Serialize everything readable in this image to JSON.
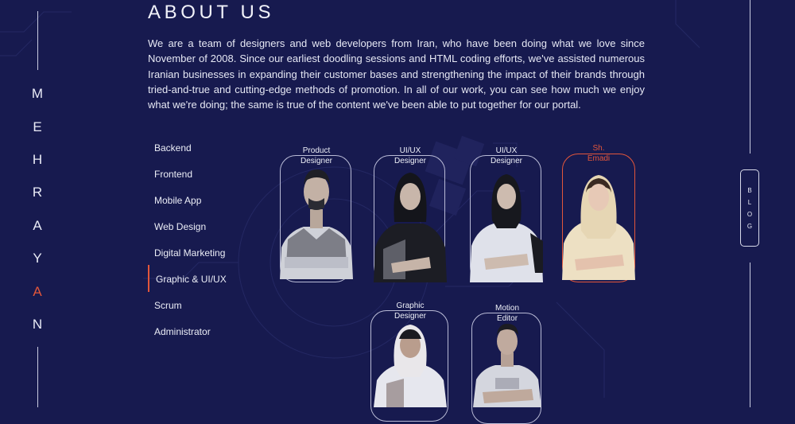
{
  "brand": {
    "letters": [
      "M",
      "E",
      "H",
      "R",
      "A",
      "Y",
      "A",
      "N"
    ],
    "accent_color": "#e2563b"
  },
  "about": {
    "title": "ABOUT US",
    "paragraph": "We are a team of designers and web developers from Iran, who have been doing what we love since November of 2008. Since our earliest doodling sessions and HTML coding efforts, we've assisted numerous Iranian businesses in expanding their customer bases and strengthening the impact of their brands through tried-and-true and cutting-edge methods of promotion. In all of our work, you can see how much we enjoy what we're doing; the same is true of the content we've been able to put together for our portal."
  },
  "menu": {
    "items": [
      "Backend",
      "Frontend",
      "Mobile App",
      "Web Design",
      "Digital Marketing",
      "Graphic & UI/UX",
      "Scrum",
      "Administrator"
    ],
    "active": "Graphic & UI/UX"
  },
  "team": [
    {
      "role_line1": "Product",
      "role_line2": "Designer",
      "highlighted": false,
      "icon": "person-photo-man-plaid-shirt"
    },
    {
      "role_line1": "UI/UX",
      "role_line2": "Designer",
      "highlighted": false,
      "icon": "person-photo-woman-hijab"
    },
    {
      "role_line1": "UI/UX",
      "role_line2": "Designer",
      "highlighted": false,
      "icon": "person-photo-woman-hijab"
    },
    {
      "role_line1": "Sh.",
      "role_line2": "Emadi",
      "highlighted": true,
      "icon": "person-photo-woman-headscarf"
    },
    {
      "role_line1": "Graphic",
      "role_line2": "Designer",
      "highlighted": false,
      "icon": "person-photo-woman-headscarf"
    },
    {
      "role_line1": "Motion",
      "role_line2": "Editor",
      "highlighted": false,
      "icon": "person-photo-man-tshirt"
    }
  ],
  "blog": {
    "letters": [
      "B",
      "L",
      "O",
      "G"
    ]
  },
  "colors": {
    "background": "#171a4f",
    "accent": "#e2563b",
    "text": "#e7e9f5"
  }
}
